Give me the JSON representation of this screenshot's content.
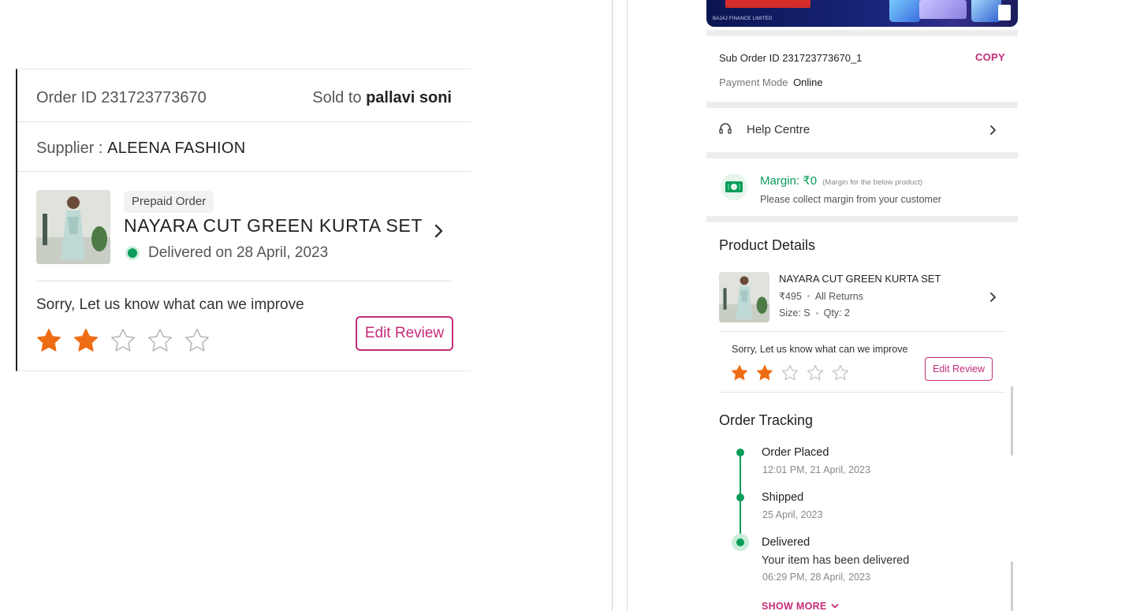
{
  "order_card": {
    "order_id": "Order ID 231723773670",
    "sold_to_label": "Sold to",
    "sold_to_name": "pallavi soni",
    "supplier_label": "Supplier :",
    "supplier_name": "ALEENA FASHION",
    "payment_chip": "Prepaid Order",
    "product_name": "NAYARA CUT GREEN KURTA SET",
    "delivery_status": "Delivered on 28 April, 2023",
    "feedback_prompt": "Sorry, Let us know what can we improve",
    "rating": 2,
    "rating_max": 5,
    "edit_review_label": "Edit Review"
  },
  "detail_panel": {
    "banner": {
      "issuer_text": "BAJAJ FINANCE LIMITED"
    },
    "sub_order_id": "Sub Order ID 231723773670_1",
    "copy_label": "COPY",
    "payment_mode_label": "Payment Mode",
    "payment_mode_value": "Online",
    "help_centre_label": "Help Centre",
    "margin": {
      "title": "Margin: ₹0",
      "note": "(Margin for the below product)",
      "subtitle": "Please collect margin from your customer"
    },
    "product_details_title": "Product Details",
    "product": {
      "name": "NAYARA CUT GREEN KURTA SET",
      "price": "₹495",
      "returns": "All Returns",
      "size": "Size: S",
      "qty": "Qty: 2"
    },
    "feedback_prompt": "Sorry, Let us know what can we improve",
    "rating": 2,
    "edit_review_label": "Edit Review",
    "order_tracking_title": "Order Tracking",
    "tracking": [
      {
        "status": "Order Placed",
        "time": "12:01 PM, 21 April, 2023"
      },
      {
        "status": "Shipped",
        "time": "25 April, 2023"
      },
      {
        "status": "Delivered",
        "description": "Your item has been delivered",
        "time": "06:29 PM, 28 April, 2023"
      }
    ],
    "show_more_label": "SHOW MORE"
  },
  "colors": {
    "accent_pink": "#c42c78",
    "success_green": "#0a9c5a",
    "star_orange": "#ee6c14",
    "star_empty": "#b5b5b5"
  }
}
